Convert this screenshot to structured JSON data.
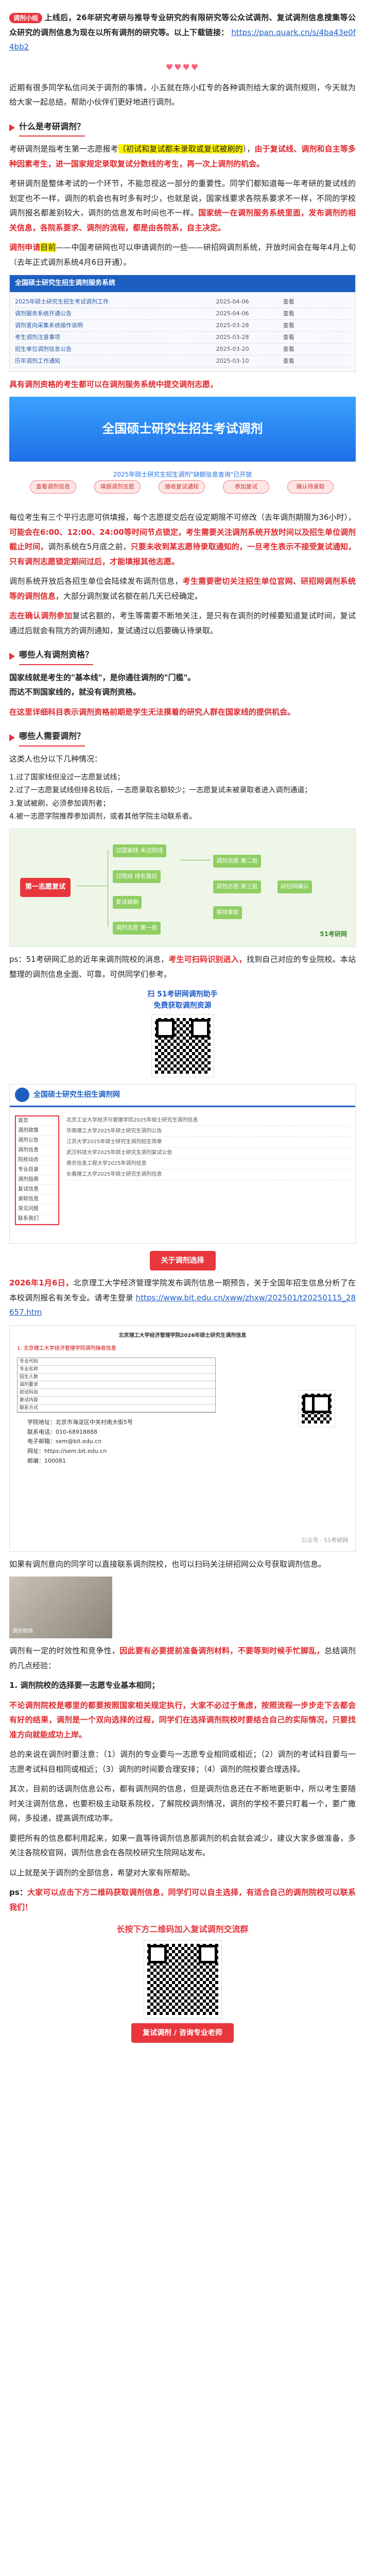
{
  "intro": {
    "badge": "调剂小组",
    "text_a": "上线后，",
    "text_b": "26年研究考研与推导专业研究的有限研究等公众试调剂、复试调剂信息搜集等公众研究的调剂信息为现在以所有调剂的研究等。以上下载链接：",
    "link": "https://pan.quark.cn/s/4ba43e0f4bb2"
  },
  "hearts": "♥♥♥♥",
  "para1": "近期有很多同学私信问关于调剂的事情，小五就在陈小红专的各种调剂给大家的调剂规则，今天就为给大家一起总结，帮助小伙伴们更好地进行调剂。",
  "sec1": {
    "title": "什么是考研调剂？"
  },
  "para2a": "考研调剂是指考生第一志愿报考",
  "para2_hl": "（初试和复试都未录取或复试被刷的",
  "para2b": "），",
  "para2_red": "由于复试线、调剂和自主等多种因素考生，进一国家规定录取复试分数线的考生，再一次上调剂的机会。",
  "para3": "考研调剂是整体考试的一个环节，不能忽视这一部分的重要性。同学们都知道每一年考研的复试线的划定也不一样，调剂的机会也有时多有时少，也就是说，国家线要求各院系要求不一样，不同的学校调剂报名都差别较大，调剂的信息发布时间也不一样。",
  "para3_red": "国家统一在调剂服务系统里面，发布调剂的相关信息，各院系要求、调剂的流程，都是由各院系，自主决定。",
  "para4a": "调剂申请",
  "para4_hl": "目前",
  "para4b": "——中国考研网也可以申请调剂的一些——研招网调剂系统",
  "para4c": "，开放时间会在每年4月上旬（去年正式调剂系统4月6日开通）。",
  "shot1": {
    "title": "全国硕士研究生招生调剂服务系统",
    "rows": [
      [
        "2025年硕士研究生招生考试调剂工作",
        "2025-04-06",
        "查看"
      ],
      [
        "调剂服务系统开通公告",
        "2025-04-06",
        "查看"
      ],
      [
        "调剂意向采集系统操作说明",
        "2025-03-28",
        "查看"
      ],
      [
        "考生调剂注意事项",
        "2025-03-28",
        "查看"
      ],
      [
        "招生单位调剂信息公告",
        "2025-03-20",
        "查看"
      ],
      [
        "历年调剂工作通知",
        "2025-03-10",
        "查看"
      ]
    ]
  },
  "para5": "具有调剂资格的考生都可以在调剂服务系统中提交调剂志愿，",
  "banner": {
    "title": "全国硕士研究生招生考试调剂",
    "subtitle": "2025年硕士研究生招生调剂\"缺额信息查询\"已开放",
    "steps": [
      "查看调剂信息",
      "填报调剂志愿",
      "接收复试通知",
      "参加复试",
      "确认待录取"
    ]
  },
  "para6a": "每位考生有三个平行志愿可供填报，每个志愿提交后在设定期限不可修改（去年调剂期限为36小时），",
  "para6_red": "可能会在6:00、12:00、24:00等时间节点锁定，考生需要关注调剂系统开放时间以及招生单位调剂截止时间，",
  "para6b": "调剂系统在5月底之前，",
  "para6_red2": "只要未收到某志愿待录取通知的，一旦考生表示不接受复试通知，只有调剂志愿锁定期间过后，才能填报其他志愿。",
  "para7a": "调剂系统开放后各招生单位会陆续发布调剂信息，",
  "para7_red": "考生需要密切关注招生单位官网、研招网调剂系统等的调剂信息，",
  "para7b": "大部分调剂复试名额在前几天已经确定。",
  "para8a": "",
  "para8_red": "志在确认调剂参加",
  "para8b": "复试名额的，考生等需要不断地关注，是只有在调剂的时候要知道复试时间，复试通过后就会有院方的调剂通知，复试通过以后要确认待录取。",
  "sec2": {
    "title": "哪些人有调剂资格？"
  },
  "para9a": "国家线就是考生的\"基本线\"，是你通往调剂的\"门槛\"。",
  "para9b": "而达不到国家线的，就没有调剂资格。",
  "para10_red": "在这里详细科目表示调剂资格前期是学生无法摸着的研究人群在国家线的提供机会。",
  "sec3": {
    "title": "哪些人需要调剂？"
  },
  "para11": "这类人也分以下几种情况：",
  "list1": [
    "1.过了国家线但没过一志愿复试线；",
    "2.过了一志愿复试线但排名较后，一志愿录取名额较少；一志愿复试未被录取者进入调剂通道；",
    "3.复试被刷，必须参加调剂者；",
    "4.被一志愿学院推荐参加调剂，或者其他学院主动联系者。"
  ],
  "mindmap": {
    "center": "第一志愿复试",
    "nodes": [
      "过国家线 未过院线",
      "过院线 排名靠后",
      "复试被刷",
      "调剂志愿 第一批",
      "调剂志愿 第二批",
      "调剂志愿 第三批",
      "等待录取",
      "研招网确认"
    ],
    "brand": "51考研网"
  },
  "para12a": "ps：51考研网汇总的近年来调剂院校的消息，",
  "para12_red": "考生可扫码识别进入，",
  "para12b": "找到自己对应的专业院校。本站整理的调剂信息全面、可靠，可供同学们参考。",
  "qr1": {
    "line1": "扫 51考研网调剂助手",
    "line2": "免费获取调剂资源"
  },
  "site": {
    "name": "全国硕士研究生招生调剂网",
    "side": [
      "首页",
      "调剂政策",
      "调剂公告",
      "调剂信息",
      "院校动态",
      "专业目录",
      "调剂指南",
      "复试信息",
      "录取信息",
      "常见问题",
      "联系我们"
    ],
    "main": [
      "北京工业大学经济与管理学院2025年硕士研究生调剂信息",
      "华南理工大学2025年硕士研究生调剂公告",
      "江苏大学2025年硕士研究生调剂招生简章",
      "武汉科技大学2025年硕士研究生调剂复试公告",
      "南京信息工程大学2025年调剂信息",
      "长春理工大学2025年硕士研究生调剂信息"
    ]
  },
  "btn1": "关于调剂选择",
  "para13a": "2026年1月6日，",
  "para13b": "北京理工大学经济管理学院发布调剂信息一期预告，关于全国年招生信息分析了在本校调剂报名有关专业。请考生登录",
  "para13_link": "https://www.bit.edu.cn/xww/zhxw/202501/t20250115_28657.htm",
  "doc": {
    "head": "北京理工大学经济管理学院2026年硕士研究生调剂信息",
    "table": [
      "专业代码",
      "专业名称",
      "招生人数",
      "调剂要求",
      "初试科目",
      "复试内容",
      "联系方式"
    ],
    "red_note": "1. 北京理工大学经济管理学院调剂接收信息",
    "watermark": "公众号 · 51考研网"
  },
  "contact": [
    "学院地址：北京市海淀区中关村南大街5号",
    "联系电话：010-68918888",
    "电子邮箱：sem@bit.edu.cn",
    "网址：https://sem.bit.edu.cn",
    "邮编：100081"
  ],
  "para14": "如果有调剂意向的同学可以直接联系调剂院校，也可以扫码关注研招网公众号获取调剂信息。",
  "photo": {
    "label": "调剂现场"
  },
  "para15a": "调剂有一定的时效性和竞争性，",
  "para15_red": "因此要有必要提前准备调剂材料，不要等到时候手忙脚乱，",
  "para15b": "总结调剂的几点经验：",
  "list2_title": "1. 调剂院校的选择要一志愿专业基本相同；",
  "para16_red": "不论调剂院校是哪里的都要按照国家相关规定执行，大家不必过于焦虑，按照流程一步步走下去都会有好的结果，调剂是一个双向选择的过程，同学们在选择调剂院校时要结合自己的实际情况，只要找准方向就能成功上岸。",
  "para17": "总的来说在调剂时要注意：（1）调剂的专业要与一志愿专业相同或相近；（2）调剂的考试科目要与一志愿考试科目相同或相近；（3）调剂的时间要合理安排；（4）调剂的院校要合理选择。",
  "para18": "其次，目前的话调剂信息公布，都有调剂网的信息，但是调剂信息还在不断地更新中，所以考生要随时关注调剂信息，也要积极主动联系院校，了解院校调剂情况，调剂的学校不要只盯着一个，要广撒网，多投递，提高调剂成功率。",
  "para19": "要把所有的信息都利用起来，如果一直等待调剂信息那调剂的机会就会减少，建议大家多做准备，多关注各院校官网，调剂信息会在各院校研究生院网站发布。",
  "para20": "以上就是关于调剂的全部信息，希望对大家有所帮助。",
  "para21a": "ps：",
  "para21_red": "大家可以点击下方二维码获取调剂信息，同学们可以自主选择，有适合自己的调剂院校可以联系我们！",
  "end": {
    "title": "长按下方二维码加入复试调剂交流群",
    "btn": "复试调剂 / 咨询专业老师"
  }
}
